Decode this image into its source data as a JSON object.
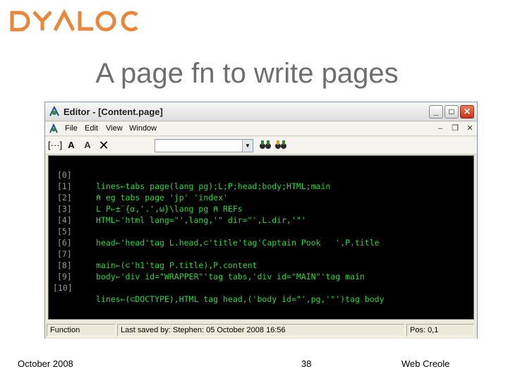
{
  "logo": {
    "text": "DYALOG",
    "color": "#e8873a"
  },
  "slide": {
    "title": "A page fn to write pages"
  },
  "editor": {
    "title": "Editor - [Content.page]",
    "menu": [
      "File",
      "Edit",
      "View",
      "Window"
    ],
    "toolbar": {
      "icons": [
        "ellipsis-icon",
        "font-a-icon",
        "font-a-color-icon",
        "close-x-icon",
        "find-binoculars-icon",
        "replace-binoculars-icon"
      ],
      "combo_value": ""
    },
    "lines": [
      {
        "num": "[0]",
        "code": "lines←tabs page(lang pg);L;P;head;body;HTML;main"
      },
      {
        "num": "[1]",
        "code": "⍝ eg tabs page 'jp' 'index'"
      },
      {
        "num": "[2]",
        "code": "L P←±¨{⍺,'.',⍵}\\lang pg ⍝ REFs"
      },
      {
        "num": "[3]",
        "code": "HTML←'html lang=\"',lang,'\" dir=\"',L.dir,'\"'"
      },
      {
        "num": "[4]",
        "code": ""
      },
      {
        "num": "[5]",
        "code": "head←'head'tag L.head,⊂'title'tag'Captain Pook   ',P.title"
      },
      {
        "num": "[6]",
        "code": ""
      },
      {
        "num": "[7]",
        "code": "main←(⊂'h1'tag P.title),P.content"
      },
      {
        "num": "[8]",
        "code": "body←'div id=\"WRAPPER\"'tag tabs,'div id=\"MAIN\"'tag main"
      },
      {
        "num": "[9]",
        "code": ""
      },
      {
        "num": "[10]",
        "code": "lines←(⊂DOCTYPE),HTML tag head,('body id=\"',pg,'\"')tag body"
      }
    ],
    "status": {
      "mode": "Function",
      "saved": "Last saved by: Stephen: 05 October 2008 16:56",
      "pos": "Pos: 0,1"
    }
  },
  "footer": {
    "date": "October 2008",
    "page": "38",
    "topic": "Web Creole"
  }
}
